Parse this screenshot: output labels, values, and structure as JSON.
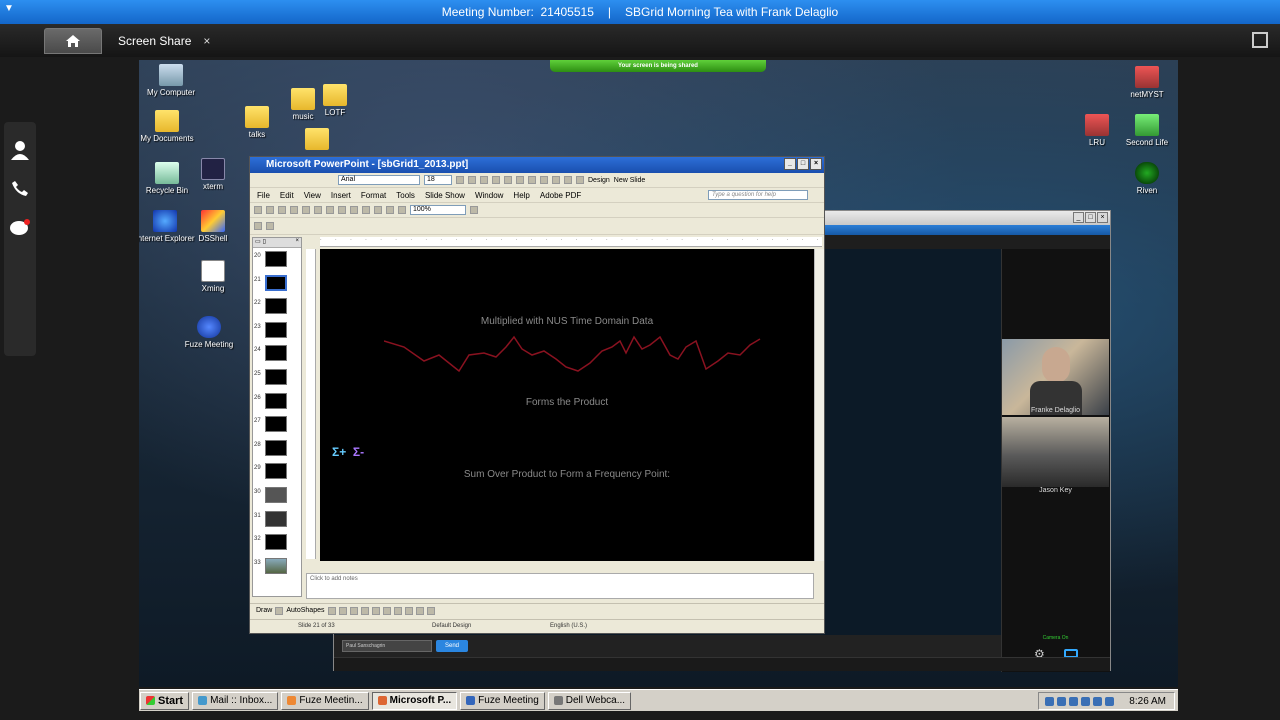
{
  "fuze": {
    "meeting_label": "Meeting Number:",
    "meeting_number": "21405515",
    "separator": "|",
    "meeting_title": "SBGrid Morning Tea with Frank Delaglio",
    "tab_label": "Screen Share",
    "tab_close": "×"
  },
  "share_banner": "Your screen is being shared",
  "desktop_icons": {
    "my_computer": "My Computer",
    "my_documents": "My Documents",
    "recycle_bin": "Recycle Bin",
    "internet_explorer": "Internet Explorer",
    "xterm": "xterm",
    "dsshell": "DSShell",
    "xming": "Xming",
    "fuze_meeting": "Fuze Meeting",
    "talks": "talks",
    "music": "music",
    "lotf": "LOTF",
    "netmyst": "netMYST",
    "lru": "LRU",
    "second_life": "Second Life",
    "riven": "Riven"
  },
  "ppt": {
    "title": "Microsoft PowerPoint - [sbGrid1_2013.ppt]",
    "font_name": "Arial",
    "font_size": "18",
    "design_label": "Design",
    "new_slide_label": "New Slide",
    "menu": [
      "File",
      "Edit",
      "View",
      "Insert",
      "Format",
      "Tools",
      "Slide Show",
      "Window",
      "Help",
      "Adobe PDF"
    ],
    "question_placeholder": "Type a question for help",
    "zoom": "100%",
    "thumb_numbers": [
      "20",
      "21",
      "22",
      "23",
      "24",
      "25",
      "26",
      "27",
      "28",
      "29",
      "30",
      "31",
      "32",
      "33"
    ],
    "selected_slide": "21",
    "slide_text": {
      "line1": "Multiplied with NUS Time Domain Data",
      "line2": "Forms the Product",
      "line3": "Sum Over Product to Form a Frequency Point:",
      "sigma_plus": "Σ+",
      "sigma_minus": "Σ-"
    },
    "notes_placeholder": "Click to add notes",
    "draw_label": "Draw",
    "autoshapes_label": "AutoShapes",
    "status_slide": "Slide 21 of 33",
    "status_design": "Default Design",
    "status_lang": "English (U.S.)"
  },
  "fuze_panel": {
    "participant1": "Franke Delaglio",
    "participant2": "Jason Key",
    "camera_status": "Camera On",
    "chat_to": "Paul Sanschagrin",
    "send_label": "Send"
  },
  "taskbar": {
    "start": "Start",
    "items": [
      "Mail :: Inbox...",
      "Fuze Meetin...",
      "Microsoft P...",
      "Fuze Meeting",
      "Dell Webca..."
    ],
    "active_index": 2,
    "clock": "8:26 AM"
  },
  "colors": {
    "fuze_blue": "#1e7ae0",
    "slide_bg": "#000000",
    "waveform": "#8a1220"
  }
}
